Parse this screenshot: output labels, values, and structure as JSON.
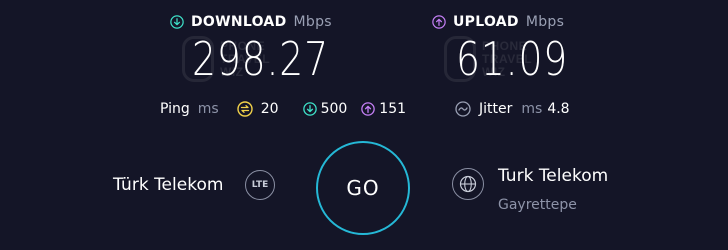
{
  "download": {
    "label": "DOWNLOAD",
    "unit": "Mbps",
    "value": "298.27",
    "color": "#3ee0c8",
    "icon": "arrow-down-circle-icon"
  },
  "upload": {
    "label": "UPLOAD",
    "unit": "Mbps",
    "value": "61.09",
    "color": "#c37ef4",
    "icon": "arrow-up-circle-icon"
  },
  "watermark": {
    "line1": "PHONE",
    "line2": "TRAVEL",
    "line3": "WIZ"
  },
  "ping": {
    "label": "Ping",
    "unit": "ms",
    "idle": "20",
    "download": "500",
    "upload": "151",
    "idle_color": "#f2d24a"
  },
  "jitter": {
    "label": "Jitter",
    "unit": "ms",
    "value": "4.8"
  },
  "go_button": {
    "label": "GO",
    "ring_color": "#25b8d6"
  },
  "isp": {
    "name": "Türk Telekom",
    "badge": "LTE"
  },
  "server": {
    "name": "Turk Telekom",
    "location": "Gayrettepe"
  }
}
